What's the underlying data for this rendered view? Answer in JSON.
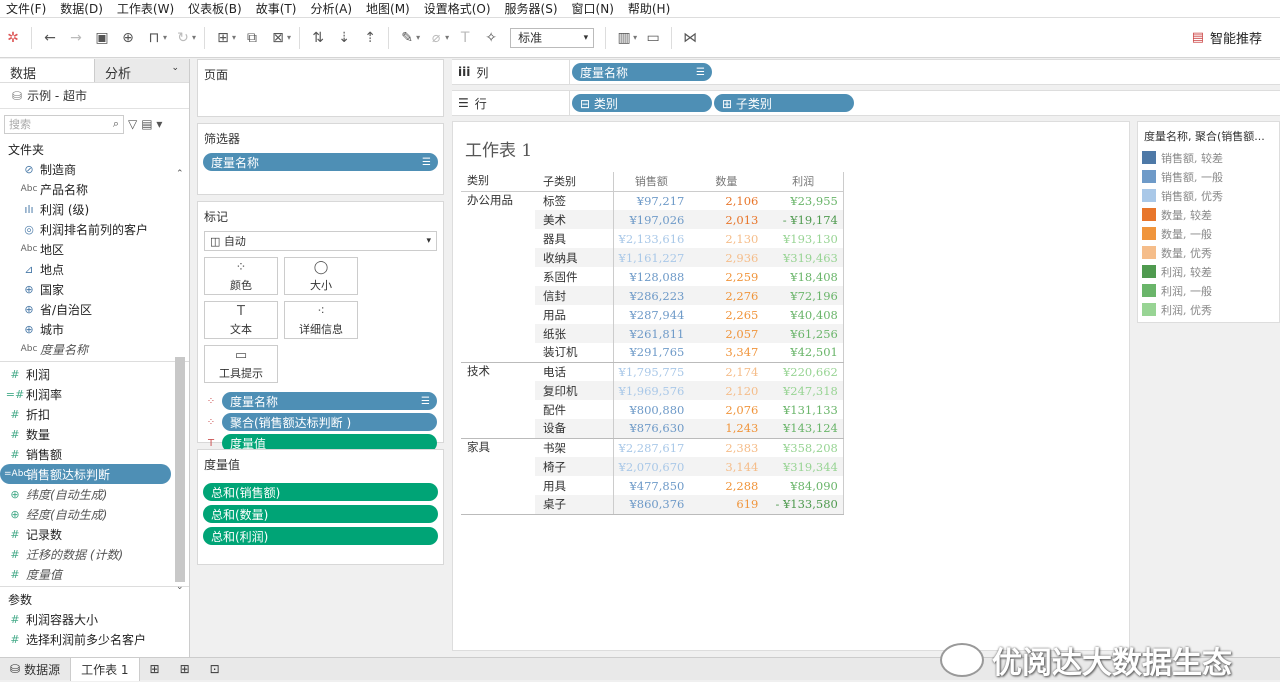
{
  "menu": [
    "文件(F)",
    "数据(D)",
    "工作表(W)",
    "仪表板(B)",
    "故事(T)",
    "分析(A)",
    "地图(M)",
    "设置格式(O)",
    "服务器(S)",
    "窗口(N)",
    "帮助(H)"
  ],
  "toolbar": {
    "fit_value": "标准",
    "smart_label": "智能推荐"
  },
  "left_panel": {
    "tab_data": "数据",
    "tab_analysis": "分析",
    "datasource": "示例 - 超市",
    "search_placeholder": "搜索",
    "folder_title": "文件夹",
    "dims": [
      {
        "icon": "clip-icon",
        "glyph": "⊘",
        "label": "制造商"
      },
      {
        "icon": "abc-icon",
        "glyph": "Abc",
        "label": "产品名称"
      },
      {
        "icon": "bin-icon",
        "glyph": "ılı",
        "label": "利润 (级)"
      },
      {
        "icon": "set-icon",
        "glyph": "◎",
        "label": "利润排名前列的客户"
      },
      {
        "icon": "abc-icon",
        "glyph": "Abc",
        "label": "地区"
      },
      {
        "icon": "hierarchy-icon",
        "glyph": "⊿",
        "label": "地点"
      },
      {
        "icon": "globe-icon",
        "glyph": "⊕",
        "label": "国家"
      },
      {
        "icon": "globe-icon",
        "glyph": "⊕",
        "label": "省/自治区"
      },
      {
        "icon": "globe-icon",
        "glyph": "⊕",
        "label": "城市"
      },
      {
        "icon": "abc-icon",
        "glyph": "Abc",
        "label": "度量名称"
      }
    ],
    "measures": [
      {
        "icon": "hash-icon",
        "glyph": "#",
        "label": "利润"
      },
      {
        "icon": "calc-hash-icon",
        "glyph": "=#",
        "label": "利润率"
      },
      {
        "icon": "hash-icon",
        "glyph": "#",
        "label": "折扣"
      },
      {
        "icon": "hash-icon",
        "glyph": "#",
        "label": "数量"
      },
      {
        "icon": "hash-icon",
        "glyph": "#",
        "label": "销售额"
      },
      {
        "icon": "calc-abc-icon",
        "glyph": "=Abc",
        "label": "销售额达标判断"
      },
      {
        "icon": "globe-icon",
        "glyph": "⊕",
        "label": "纬度(自动生成)"
      },
      {
        "icon": "globe-icon",
        "glyph": "⊕",
        "label": "经度(自动生成)"
      },
      {
        "icon": "hash-icon",
        "glyph": "#",
        "label": "记录数"
      },
      {
        "icon": "hash-icon",
        "glyph": "#",
        "label": "迁移的数据 (计数)"
      },
      {
        "icon": "hash-icon",
        "glyph": "#",
        "label": "度量值"
      }
    ],
    "params_title": "参数",
    "params": [
      {
        "icon": "hash-icon",
        "glyph": "#",
        "label": "利润容器大小"
      },
      {
        "icon": "hash-icon",
        "glyph": "#",
        "label": "选择利润前多少名客户"
      }
    ]
  },
  "cards": {
    "pages_title": "页面",
    "filters_title": "筛选器",
    "filter_pill": "度量名称",
    "marks_title": "标记",
    "marks_type": "自动",
    "mark_buttons": [
      {
        "icon": "color-icon",
        "glyph": "⁘",
        "label": "颜色"
      },
      {
        "icon": "size-icon",
        "glyph": "◯",
        "label": "大小"
      },
      {
        "icon": "text-icon",
        "glyph": "T",
        "label": "文本"
      },
      {
        "icon": "detail-icon",
        "glyph": "⁖",
        "label": "详细信息"
      },
      {
        "icon": "tooltip-icon",
        "glyph": "▭",
        "label": "工具提示"
      }
    ],
    "mark_pills": [
      {
        "icon": "color-icon",
        "glyph": "⁘",
        "label": "度量名称",
        "color": "blue"
      },
      {
        "icon": "color-icon",
        "glyph": "⁘",
        "label": "聚合(销售额达标判断 )",
        "color": "blue"
      },
      {
        "icon": "text-icon",
        "glyph": "T",
        "label": "度量值",
        "color": "green"
      }
    ],
    "measure_values_title": "度量值",
    "measure_values": [
      "总和(销售额)",
      "总和(数量)",
      "总和(利润)"
    ]
  },
  "shelves": {
    "columns_label": "列",
    "columns_pill": "度量名称",
    "rows_label": "行",
    "rows_pills": [
      "⊟ 类别",
      "⊞ 子类别"
    ]
  },
  "sheet": {
    "title": "工作表 1",
    "headers": [
      "类别",
      "子类别",
      "销售额",
      "数量",
      "利润"
    ],
    "colors": {
      "sales": {
        "low": "#4e79a7",
        "mid": "#6e9ac8",
        "high": "#a9c8e8"
      },
      "qty": {
        "low": "#e8762b",
        "mid": "#f0953c",
        "high": "#f5bd8a"
      },
      "profit": {
        "low": "#4f9a4f",
        "mid": "#6ab56a",
        "high": "#98d494"
      }
    },
    "groups": [
      {
        "category": "办公用品",
        "rows": [
          {
            "sub": "标签",
            "sales": "¥97,217",
            "qty": "2,106",
            "profit": "¥23,955",
            "s": "mid",
            "q": "low",
            "p": "mid"
          },
          {
            "sub": "美术",
            "sales": "¥197,026",
            "qty": "2,013",
            "profit": "- ¥19,174",
            "s": "mid",
            "q": "low",
            "p": "low"
          },
          {
            "sub": "器具",
            "sales": "¥2,133,616",
            "qty": "2,130",
            "profit": "¥193,130",
            "s": "high",
            "q": "high",
            "p": "high"
          },
          {
            "sub": "收纳具",
            "sales": "¥1,161,227",
            "qty": "2,936",
            "profit": "¥319,463",
            "s": "high",
            "q": "high",
            "p": "high"
          },
          {
            "sub": "系固件",
            "sales": "¥128,088",
            "qty": "2,259",
            "profit": "¥18,408",
            "s": "mid",
            "q": "mid",
            "p": "mid"
          },
          {
            "sub": "信封",
            "sales": "¥286,223",
            "qty": "2,276",
            "profit": "¥72,196",
            "s": "mid",
            "q": "mid",
            "p": "mid"
          },
          {
            "sub": "用品",
            "sales": "¥287,944",
            "qty": "2,265",
            "profit": "¥40,408",
            "s": "mid",
            "q": "mid",
            "p": "mid"
          },
          {
            "sub": "纸张",
            "sales": "¥261,811",
            "qty": "2,057",
            "profit": "¥61,256",
            "s": "mid",
            "q": "mid",
            "p": "mid"
          },
          {
            "sub": "装订机",
            "sales": "¥291,765",
            "qty": "3,347",
            "profit": "¥42,501",
            "s": "mid",
            "q": "mid",
            "p": "mid"
          }
        ]
      },
      {
        "category": "技术",
        "rows": [
          {
            "sub": "电话",
            "sales": "¥1,795,775",
            "qty": "2,174",
            "profit": "¥220,662",
            "s": "high",
            "q": "high",
            "p": "high"
          },
          {
            "sub": "复印机",
            "sales": "¥1,969,576",
            "qty": "2,120",
            "profit": "¥247,318",
            "s": "high",
            "q": "high",
            "p": "high"
          },
          {
            "sub": "配件",
            "sales": "¥800,880",
            "qty": "2,076",
            "profit": "¥131,133",
            "s": "mid",
            "q": "mid",
            "p": "mid"
          },
          {
            "sub": "设备",
            "sales": "¥876,630",
            "qty": "1,243",
            "profit": "¥143,124",
            "s": "mid",
            "q": "mid",
            "p": "mid"
          }
        ]
      },
      {
        "category": "家具",
        "rows": [
          {
            "sub": "书架",
            "sales": "¥2,287,617",
            "qty": "2,383",
            "profit": "¥358,208",
            "s": "high",
            "q": "high",
            "p": "high"
          },
          {
            "sub": "椅子",
            "sales": "¥2,070,670",
            "qty": "3,144",
            "profit": "¥319,344",
            "s": "high",
            "q": "high",
            "p": "high"
          },
          {
            "sub": "用具",
            "sales": "¥477,850",
            "qty": "2,288",
            "profit": "¥84,090",
            "s": "mid",
            "q": "mid",
            "p": "mid"
          },
          {
            "sub": "桌子",
            "sales": "¥860,376",
            "qty": "619",
            "profit": "- ¥133,580",
            "s": "mid",
            "q": "mid",
            "p": "low"
          }
        ]
      }
    ]
  },
  "legend": {
    "title": "度量名称, 聚合(销售额...",
    "items": [
      {
        "label": "销售额, 较差",
        "color": "#4e79a7"
      },
      {
        "label": "销售额, 一般",
        "color": "#6e9ac8"
      },
      {
        "label": "销售额, 优秀",
        "color": "#a9c8e8"
      },
      {
        "label": "数量, 较差",
        "color": "#e8762b"
      },
      {
        "label": "数量, 一般",
        "color": "#f0953c"
      },
      {
        "label": "数量, 优秀",
        "color": "#f5bd8a"
      },
      {
        "label": "利润, 较差",
        "color": "#4f9a4f"
      },
      {
        "label": "利润, 一般",
        "color": "#6ab56a"
      },
      {
        "label": "利润, 优秀",
        "color": "#98d494"
      }
    ]
  },
  "bottom": {
    "datasource_tab": "数据源",
    "sheet_tab": "工作表 1"
  },
  "watermark": "优阅达大数据生态"
}
